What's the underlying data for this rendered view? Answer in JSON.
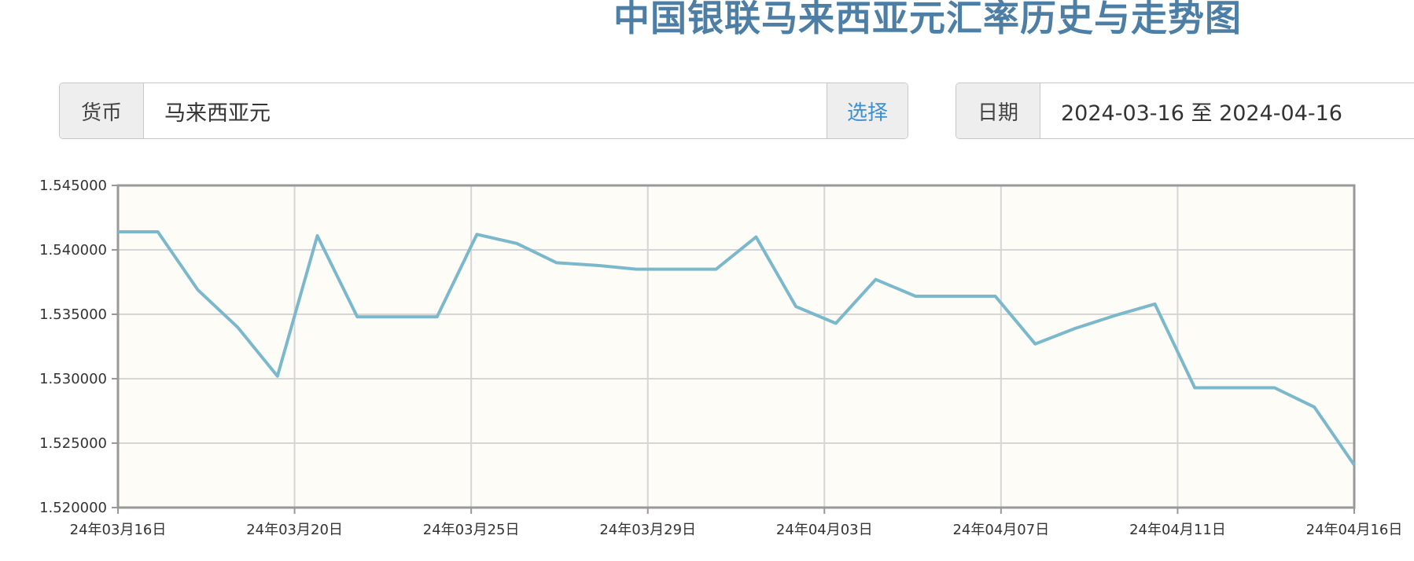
{
  "page": {
    "title": "中国银联马来西亚元汇率历史与走势图"
  },
  "currency": {
    "label": "货币",
    "value": "马来西亚元",
    "button": "选择"
  },
  "date": {
    "label": "日期",
    "value": "2024-03-16 至 2024-04-16"
  },
  "colors": {
    "line": "#7bb8cc",
    "plot_background": "#fdfcf7",
    "grid": "#d6d6d6",
    "frame": "#999999",
    "title": "#4d7fa6",
    "button_text": "#3d8fd1"
  },
  "chart_data": {
    "type": "line",
    "title": "",
    "xlabel": "",
    "ylabel": "",
    "ylim": [
      1.52,
      1.545
    ],
    "y_ticks": [
      "1.545000",
      "1.540000",
      "1.535000",
      "1.530000",
      "1.525000",
      "1.520000"
    ],
    "x_ticks": [
      {
        "label": "24年03月16日",
        "index": 0
      },
      {
        "label": "24年03月20日",
        "index": 4.5
      },
      {
        "label": "24年03月25日",
        "index": 9
      },
      {
        "label": "24年03月29日",
        "index": 13.5
      },
      {
        "label": "24年04月03日",
        "index": 18
      },
      {
        "label": "24年04月07日",
        "index": 22.5
      },
      {
        "label": "24年04月11日",
        "index": 27
      },
      {
        "label": "24年04月16日",
        "index": 31.5
      }
    ],
    "x_index_range": [
      0,
      31.5
    ],
    "grid": true,
    "series": [
      {
        "values": [
          1.5414,
          1.5414,
          1.5369,
          1.534,
          1.5302,
          1.5411,
          1.5348,
          1.5348,
          1.5348,
          1.5412,
          1.5405,
          1.539,
          1.5388,
          1.5385,
          1.5385,
          1.5385,
          1.541,
          1.5356,
          1.5343,
          1.5377,
          1.5364,
          1.5364,
          1.5364,
          1.5327,
          1.5339,
          1.5349,
          1.5358,
          1.5293,
          1.5293,
          1.5293,
          1.5278,
          1.5233
        ]
      }
    ]
  }
}
